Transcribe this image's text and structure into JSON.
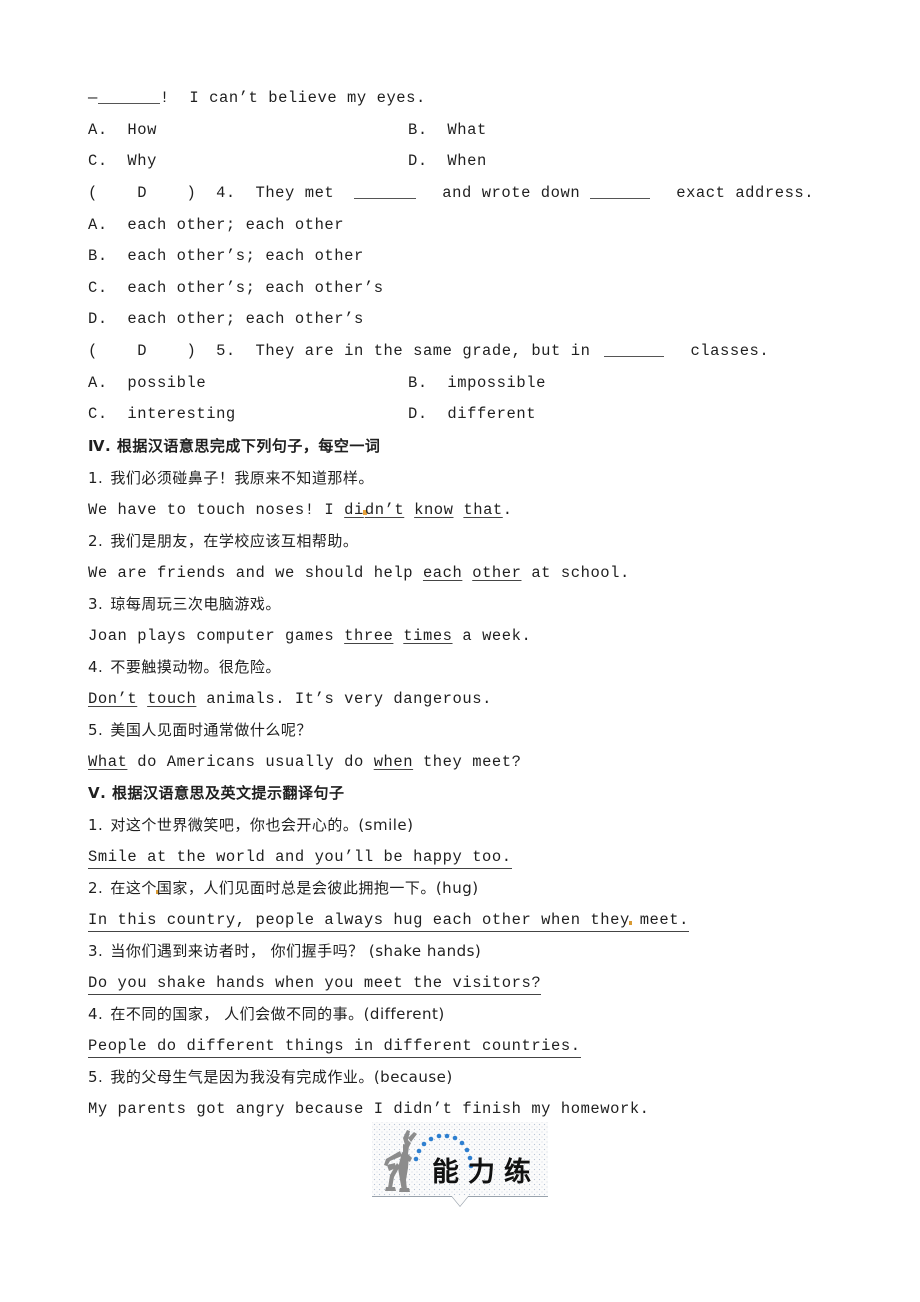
{
  "document": {
    "lines": [
      {
        "id": "q3-stem",
        "text": "—"
      },
      {
        "id": "q3-stem-tail",
        "text": "!  I can’t believe my eyes."
      },
      {
        "id": "q3-optA",
        "text": "A.  How"
      },
      {
        "id": "q3-optB",
        "text": "B.  What"
      },
      {
        "id": "q3-optC",
        "text": "C.  Why"
      },
      {
        "id": "q3-optD",
        "text": "D.  When"
      },
      {
        "id": "q4-prefix",
        "text": "(    D    )  4.  They met"
      },
      {
        "id": "q4-mid",
        "text": "and wrote down"
      },
      {
        "id": "q4-tail",
        "text": "exact address."
      },
      {
        "id": "q4-optA",
        "text": "A.  each other; each other"
      },
      {
        "id": "q4-optB",
        "text": "B.  each other’s; each other"
      },
      {
        "id": "q4-optC",
        "text": "C.  each other’s; each other’s"
      },
      {
        "id": "q4-optD",
        "text": "D.  each other; each other’s"
      },
      {
        "id": "q5-prefix",
        "text": "(    D    )  5.  They are in the same grade, but in"
      },
      {
        "id": "q5-tail",
        "text": "classes."
      },
      {
        "id": "q5-optA",
        "text": "A.  possible"
      },
      {
        "id": "q5-optB",
        "text": "B.  impossible"
      },
      {
        "id": "q5-optC",
        "text": "C.  interesting"
      },
      {
        "id": "q5-optD",
        "text": "D.  different"
      }
    ],
    "section_iv": {
      "heading": "Ⅳ. 根据汉语意思完成下列句子，每空一词",
      "items": [
        {
          "number": "1.",
          "chinese": "我们必须碰鼻子！我原来不知道那样。",
          "english_pre": "We have to touch noses! I ",
          "english_answers": [
            "didn’t",
            "know",
            "that"
          ],
          "english_post": "."
        },
        {
          "number": "2.",
          "chinese": "我们是朋友，在学校应该互相帮助。",
          "english_pre": "We are friends and we should help ",
          "english_answers": [
            "each",
            "other"
          ],
          "english_post": " at school."
        },
        {
          "number": "3.",
          "chinese": "琼每周玩三次电脑游戏。",
          "english_pre": "Joan plays computer games ",
          "english_answers": [
            "three",
            "times"
          ],
          "english_post": " a week."
        },
        {
          "number": "4.",
          "chinese": "不要触摸动物。很危险。",
          "english_pre": "",
          "english_answers": [
            "Don’t",
            "touch"
          ],
          "english_post": " animals. It’s very dangerous."
        },
        {
          "number": "5.",
          "chinese": "美国人见面时通常做什么呢？",
          "english_pre": "",
          "english_answers": [
            "What"
          ],
          "english_mid": " do Americans usually do ",
          "english_answers2": [
            "when"
          ],
          "english_post": " they meet?"
        }
      ]
    },
    "section_v": {
      "heading": "Ⅴ. 根据汉语意思及英文提示翻译句子",
      "items": [
        {
          "number": "1.",
          "chinese": "对这个世界微笑吧，你也会开心的。(smile)",
          "hint": "smile",
          "answer": "Smile at the world and you’ll be happy too."
        },
        {
          "number": "2.",
          "chinese": "在这个国家，人们见面时总是会彼此拥抱一下。(hug)",
          "hint": "hug",
          "answer": "In this country, people always hug each other when they meet."
        },
        {
          "number": "3.",
          "chinese": "当你们遇到来访者时， 你们握手吗？ (shake hands)",
          "hint": "shake hands",
          "answer": "Do you shake hands when you meet the visitors?"
        },
        {
          "number": "4.",
          "chinese": "在不同的国家， 人们会做不同的事。(different)",
          "hint": "different",
          "answer": "People do different things in different countries."
        },
        {
          "number": "5.",
          "chinese": "我的父母生气是因为我没有完成作业。(because)",
          "hint": "because",
          "answer": "My parents got angry because I didn’t finish my homework."
        }
      ]
    },
    "banner": {
      "label": "能力练",
      "icon_figure": "dancing-person-silhouette",
      "icon_arc": "blue-dotted-arc",
      "dot_color": "#2e7fd0",
      "figure_color": "#8c8c8c",
      "background": "#fbfbfb"
    }
  }
}
